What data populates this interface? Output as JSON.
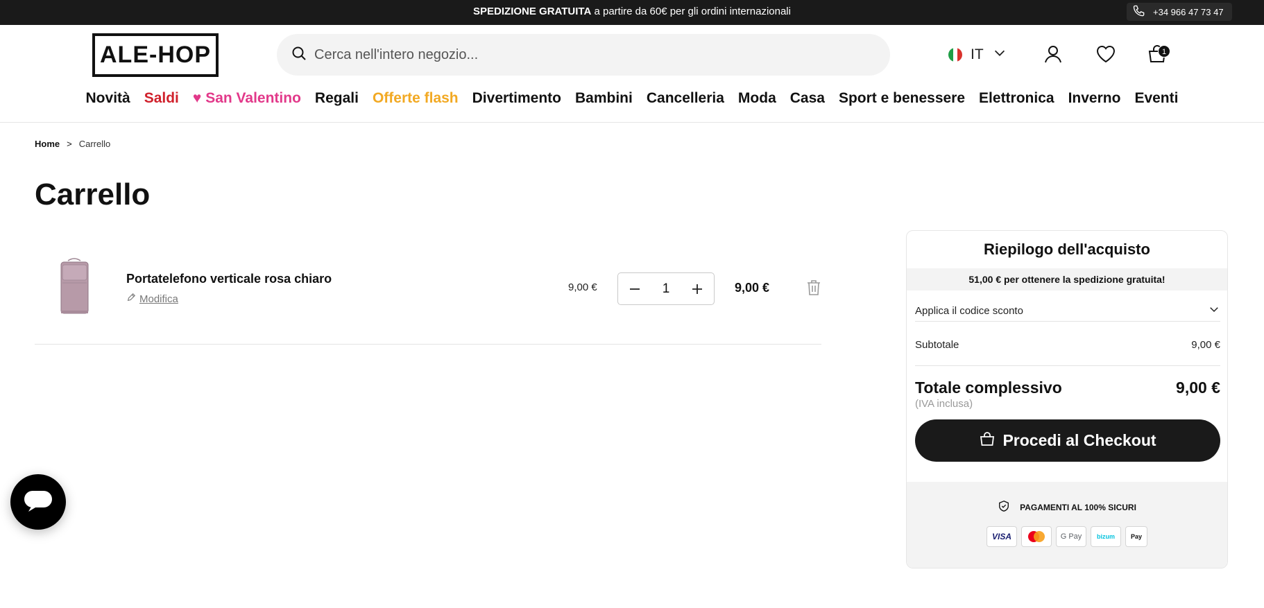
{
  "topbar": {
    "promo_bold": "SPEDIZIONE GRATUITA",
    "promo_rest": " a partire da 60€ per gli ordini internazionali",
    "phone": "+34 966 47 73 47"
  },
  "header": {
    "logo": "ALE-HOP",
    "search_placeholder": "Cerca nell'intero negozio...",
    "language": "IT",
    "cart_count": "1"
  },
  "nav": [
    {
      "label": "Novità",
      "color": "#111111"
    },
    {
      "label": "Saldi",
      "color": "#d0212c"
    },
    {
      "label": "♥ San Valentino",
      "color": "#e2398a"
    },
    {
      "label": "Regali",
      "color": "#111111"
    },
    {
      "label": "Offerte flash",
      "color": "#f2a923"
    },
    {
      "label": "Divertimento",
      "color": "#111111"
    },
    {
      "label": "Bambini",
      "color": "#111111"
    },
    {
      "label": "Cancelleria",
      "color": "#111111"
    },
    {
      "label": "Moda",
      "color": "#111111"
    },
    {
      "label": "Casa",
      "color": "#111111"
    },
    {
      "label": "Sport e benessere",
      "color": "#111111"
    },
    {
      "label": "Elettronica",
      "color": "#111111"
    },
    {
      "label": "Inverno",
      "color": "#111111"
    },
    {
      "label": "Eventi",
      "color": "#111111"
    }
  ],
  "breadcrumb": {
    "home": "Home",
    "separator": ">",
    "current": "Carrello"
  },
  "page_title": "Carrello",
  "cart": {
    "item": {
      "name": "Portatelefono verticale rosa chiaro",
      "edit_label": "Modifica",
      "unit_price": "9,00 €",
      "quantity": "1",
      "line_total": "9,00 €"
    }
  },
  "summary": {
    "title": "Riepilogo dell'acquisto",
    "shipping_note": "51,00 € per ottenere la spedizione gratuita!",
    "coupon_label": "Applica il codice sconto",
    "subtotal_label": "Subtotale",
    "subtotal_value": "9,00 €",
    "total_label": "Totale complessivo",
    "total_value": "9,00 €",
    "vat_note": "(IVA inclusa)",
    "checkout_label": "Procedi al Checkout",
    "secure_label": "PAGAMENTI AL 100% SICURI",
    "payment_methods": [
      "VISA",
      "",
      "G Pay",
      "bizum",
      "Pay"
    ]
  },
  "colors": {
    "dark": "#1a1a1a",
    "sale_red": "#d0212c",
    "valentine_pink": "#e2398a",
    "flash_orange": "#f2a923",
    "product": "#b79aa8"
  },
  "icons": {
    "phone": "phone-icon",
    "search": "search-icon",
    "account": "user-icon",
    "wishlist": "heart-icon",
    "cart": "cart-icon",
    "chat": "chat-icon"
  }
}
